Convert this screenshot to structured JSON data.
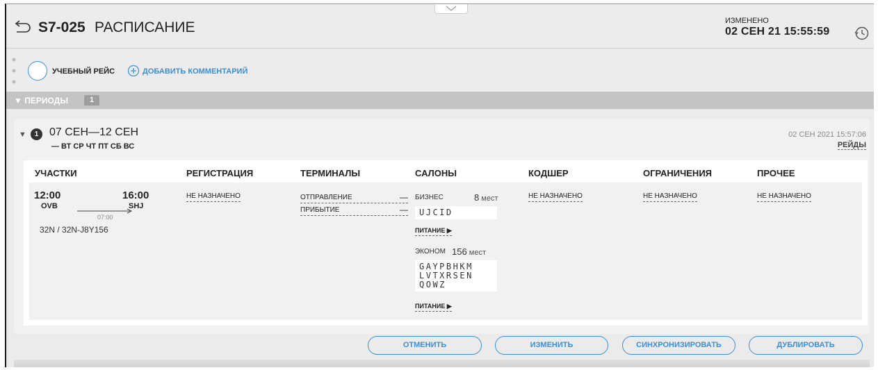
{
  "header": {
    "flight_code": "S7-025",
    "title": "РАСПИСАНИЕ",
    "changed_label": "ИЗМЕНЕНО",
    "changed_date": "02 СЕН 21 15:55:59"
  },
  "actions": {
    "training_flight": "УЧЕБНЫЙ РЕЙС",
    "add_comment": "ДОБАВИТЬ КОММЕНТАРИЙ"
  },
  "periods": {
    "label": "ПЕРИОДЫ",
    "count": "1",
    "items": [
      {
        "number": "1",
        "dates": "07 СЕН—12 СЕН",
        "days": "— ВТ СР ЧТ ПТ СБ ВС",
        "updated": "02 СЕН 2021 15:57:06",
        "flights_link": "РЕЙДЫ"
      }
    ]
  },
  "columns": [
    "УЧАСТКИ",
    "РЕГИСТРАЦИЯ",
    "ТЕРМИНАЛЫ",
    "САЛОНЫ",
    "КОДШЕР",
    "ОГРАНИЧЕНИЯ",
    "ПРОЧЕЕ"
  ],
  "leg": {
    "dep_time": "12:00",
    "dep_airport": "OVB",
    "arr_time": "16:00",
    "arr_airport": "SHJ",
    "duration": "07:00",
    "aircraft": "32N / 32N-J8Y156"
  },
  "registration": "НЕ НАЗНАЧЕНО",
  "terminals": {
    "departure": "ОТПРАВЛЕНИЕ",
    "arrival": "ПРИБЫТИЕ",
    "dash": "—"
  },
  "cabins": [
    {
      "name": "БИЗНЕС",
      "seats": "8",
      "unit": "мест",
      "codes": [
        "UJCID"
      ],
      "meal": "ПИТАНИЕ ▶"
    },
    {
      "name": "ЭКОНОМ",
      "seats": "156",
      "unit": "мест",
      "codes": [
        "GAYPBHKM",
        "LVTXRSEN",
        "QOWZ"
      ],
      "meal": "ПИТАНИЕ ▶"
    }
  ],
  "codeshare": "НЕ НАЗНАЧЕНО",
  "restrictions": "НЕ НАЗНАЧЕНО",
  "other": "НЕ НАЗНАЧЕНО",
  "buttons": {
    "cancel": "ОТМЕНИТЬ",
    "edit": "ИЗМЕНИТЬ",
    "sync": "СИНХРОНИЗИРОВАТЬ",
    "duplicate": "ДУБЛИРОВАТЬ"
  },
  "colors": {
    "accent": "#3a8fd9",
    "header_bg": "#ececec",
    "periods_bar": "#c4c4c4"
  }
}
